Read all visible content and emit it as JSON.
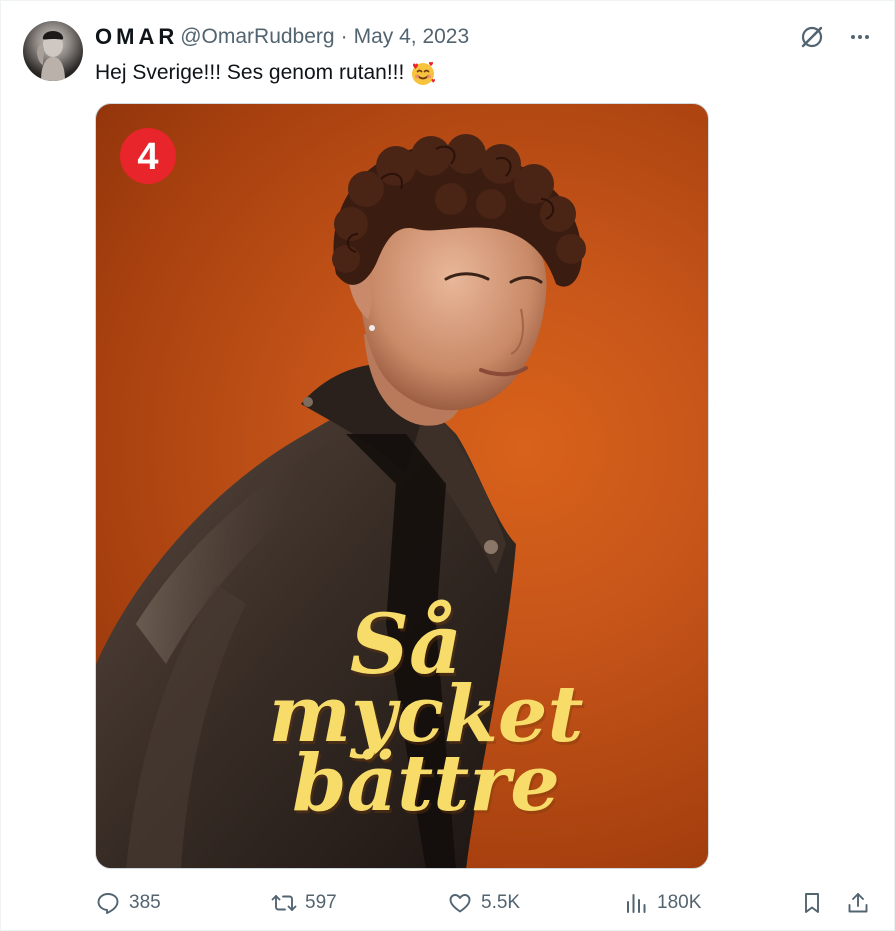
{
  "tweet": {
    "display_name": "OMAR",
    "handle": "@OmarRudberg",
    "separator": "·",
    "date": "May 4, 2023",
    "text": "Hej Sverige!!! Ses genom rutan!!!",
    "emoji": "smiling-face-with-hearts",
    "avatar_alt": "profile photo"
  },
  "top_actions": {
    "grok_icon": "grok-icon",
    "more_icon": "more-icon"
  },
  "media": {
    "channel_logo_text": "4",
    "poster_title_line1": "Så",
    "poster_title_line2": "mycket",
    "poster_title_line3": "bättre",
    "colors": {
      "background": "#c8561a",
      "title": "#f7dc6a",
      "logo_red": "#e8252a"
    }
  },
  "actions": {
    "replies": "385",
    "retweets": "597",
    "likes": "5.5K",
    "views": "180K"
  },
  "colors": {
    "text_primary": "#0f1419",
    "text_secondary": "#536471",
    "border": "#cfd9de"
  }
}
